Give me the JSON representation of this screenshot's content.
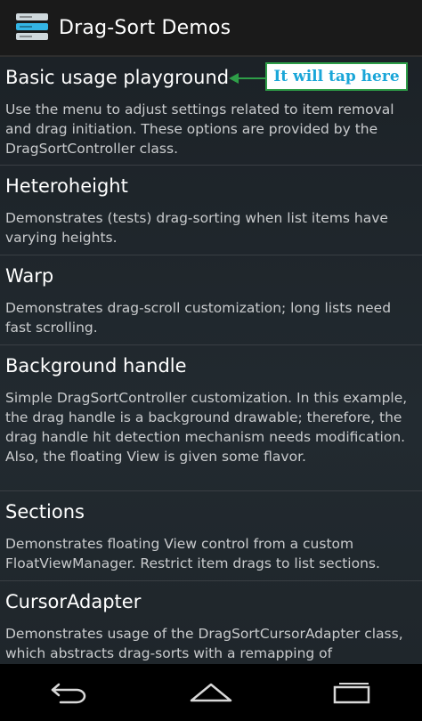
{
  "action_bar": {
    "title": "Drag-Sort Demos",
    "icon": "app-list-icon"
  },
  "annotation": {
    "text": "It will tap here",
    "border_color": "#2e9e48",
    "text_color": "#1aa6d8"
  },
  "list": {
    "items": [
      {
        "title": "Basic usage playground",
        "description": "Use the menu to adjust settings related to item removal and drag initiation. These options are provided by the DragSortController class."
      },
      {
        "title": "Heteroheight",
        "description": "Demonstrates (tests) drag-sorting when list items have varying heights."
      },
      {
        "title": "Warp",
        "description": "Demonstrates drag-scroll customization; long lists need fast scrolling."
      },
      {
        "title": "Background handle",
        "description": "Simple DragSortController customization. In this example, the drag handle is a background drawable; therefore, the drag handle hit detection mechanism needs modification. Also, the floating View is given some flavor."
      },
      {
        "title": "Sections",
        "description": "Demonstrates floating View control from a custom FloatViewManager. Restrict item drags to list sections."
      },
      {
        "title": "CursorAdapter",
        "description": "Demonstrates usage of the DragSortCursorAdapter class, which abstracts drag-sorts with a remapping of"
      }
    ]
  },
  "nav_bar": {
    "buttons": [
      "back-icon",
      "home-icon",
      "recents-icon"
    ]
  }
}
